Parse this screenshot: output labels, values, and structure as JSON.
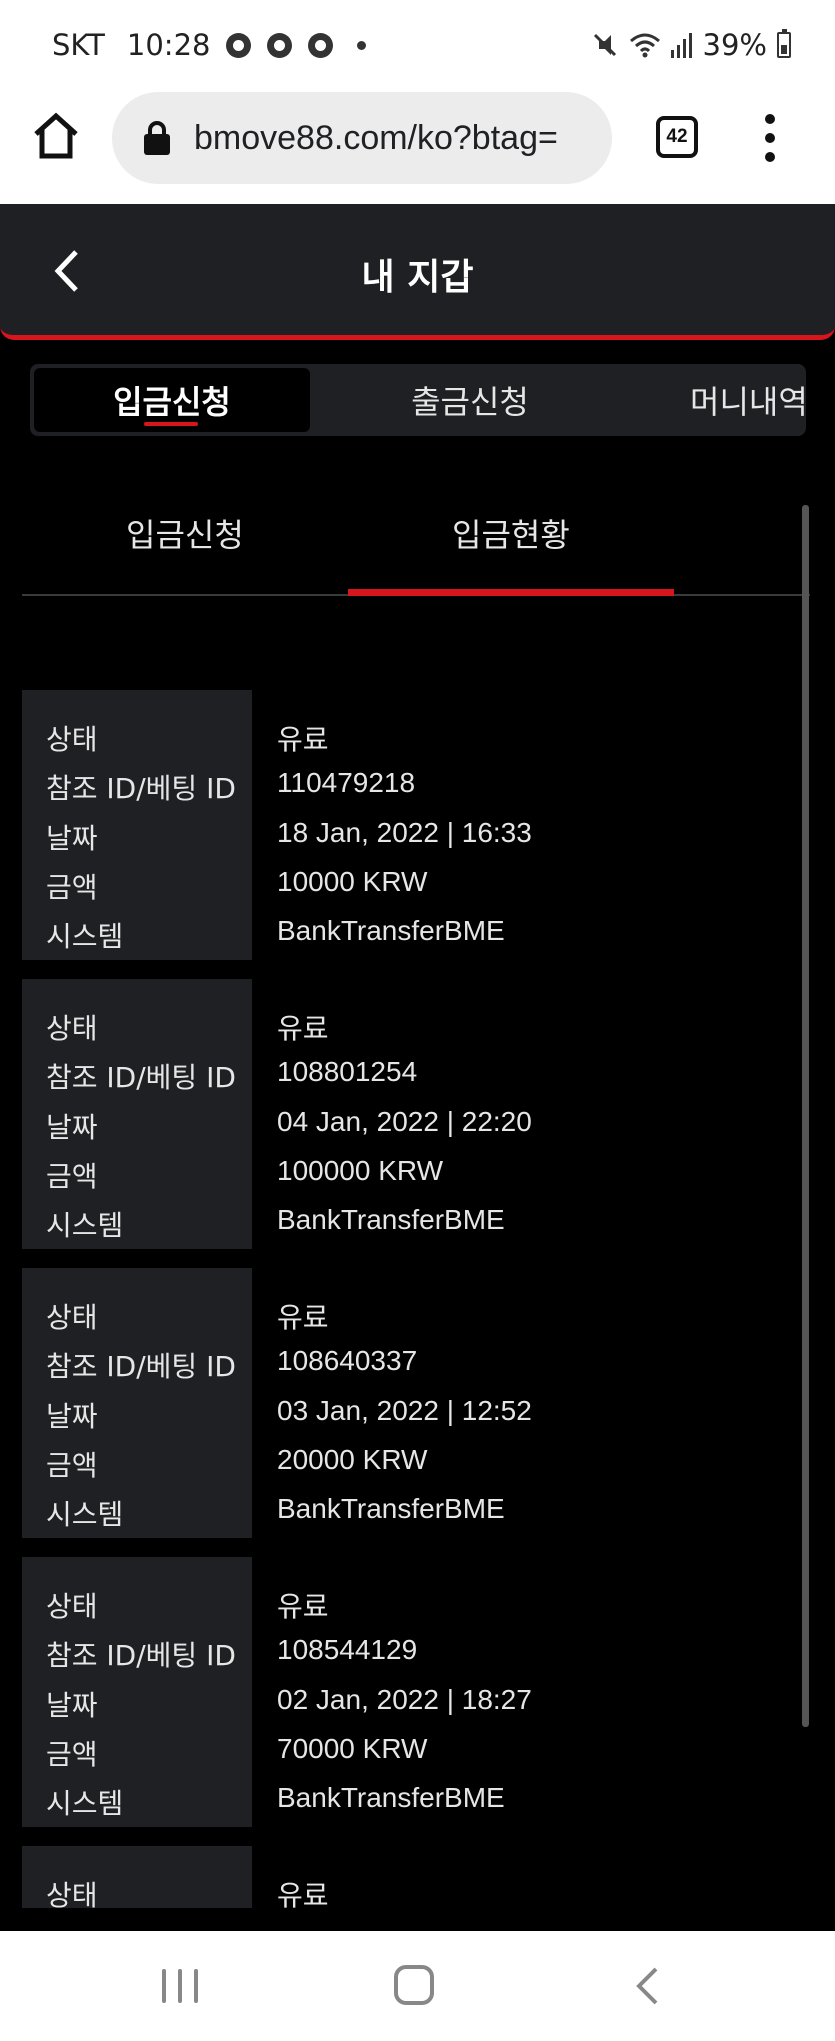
{
  "status_bar": {
    "carrier": "SKT",
    "time": "10:28",
    "battery": "39%"
  },
  "browser": {
    "url": "bmove88.com/ko?btag=",
    "tab_count": "42"
  },
  "header": {
    "title": "내 지갑"
  },
  "seg_tabs": [
    "입금신청",
    "출금신청",
    "머니내역"
  ],
  "sub_tabs": [
    "입금신청",
    "입금현황"
  ],
  "labels": {
    "status": "상태",
    "ref_id": "참조 ID/베팅 ID",
    "date": "날짜",
    "amount": "금액",
    "system": "시스템"
  },
  "records": [
    {
      "status": "유료",
      "ref_id": "110479218",
      "date": "18 Jan, 2022 | 16:33",
      "amount": "10000 KRW",
      "system": "BankTransferBME"
    },
    {
      "status": "유료",
      "ref_id": "108801254",
      "date": "04 Jan, 2022 | 22:20",
      "amount": "100000 KRW",
      "system": "BankTransferBME"
    },
    {
      "status": "유료",
      "ref_id": "108640337",
      "date": "03 Jan, 2022 | 12:52",
      "amount": "20000 KRW",
      "system": "BankTransferBME"
    },
    {
      "status": "유료",
      "ref_id": "108544129",
      "date": "02 Jan, 2022 | 18:27",
      "amount": "70000 KRW",
      "system": "BankTransferBME"
    },
    {
      "status": "유료",
      "ref_id": "",
      "date": "",
      "amount": "",
      "system": ""
    }
  ]
}
